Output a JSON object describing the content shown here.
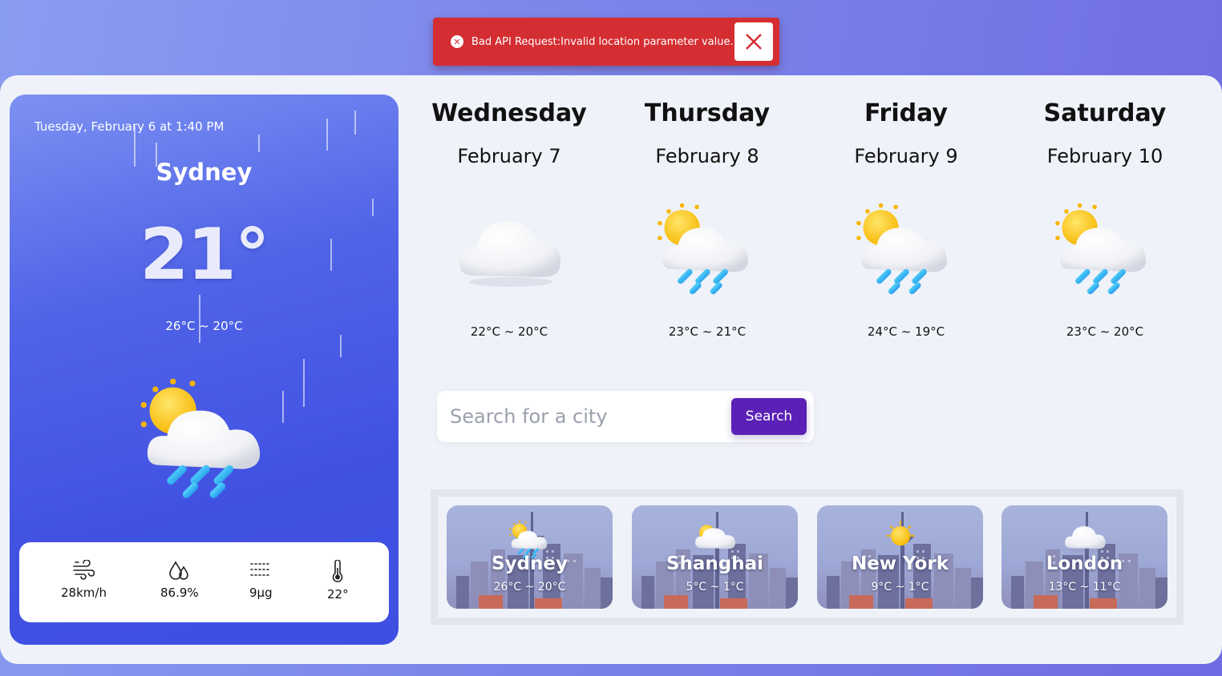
{
  "toast": {
    "message": "Bad API Request:Invalid location parameter value.",
    "icon": "error-circle-icon",
    "close_icon": "close-icon",
    "color": "#d42e32"
  },
  "current": {
    "datetime": "Tuesday, February 6 at 1:40 PM",
    "city": "Sydney",
    "temp": "21°",
    "range": "26°C ~ 20°C",
    "icon": "sun-cloud-rain-icon",
    "stats": [
      {
        "icon": "wind-icon",
        "value": "28km/h"
      },
      {
        "icon": "humidity-icon",
        "value": "86.9%"
      },
      {
        "icon": "air-quality-icon",
        "value": "9μg"
      },
      {
        "icon": "thermometer-icon",
        "value": "22°"
      }
    ]
  },
  "forecast": [
    {
      "day": "Wednesday",
      "date": "February 7",
      "range": "22°C ~ 20°C",
      "icon": "cloud-icon"
    },
    {
      "day": "Thursday",
      "date": "February 8",
      "range": "23°C ~ 21°C",
      "icon": "sun-cloud-rain-icon"
    },
    {
      "day": "Friday",
      "date": "February 9",
      "range": "24°C ~ 19°C",
      "icon": "sun-cloud-rain-icon"
    },
    {
      "day": "Saturday",
      "date": "February 10",
      "range": "23°C ~ 20°C",
      "icon": "sun-cloud-rain-icon"
    }
  ],
  "search": {
    "placeholder": "Search for a city",
    "button_label": "Search",
    "button_color": "#5b21b6"
  },
  "cities": [
    {
      "name": "Sydney",
      "range": "26°C ~ 20°C",
      "icon": "sun-cloud-rain-icon"
    },
    {
      "name": "Shanghai",
      "range": "5°C ~ 1°C",
      "icon": "sun-cloud-icon"
    },
    {
      "name": "New York",
      "range": "9°C ~ 1°C",
      "icon": "sun-icon"
    },
    {
      "name": "London",
      "range": "13°C ~ 11°C",
      "icon": "cloud-icon"
    }
  ]
}
